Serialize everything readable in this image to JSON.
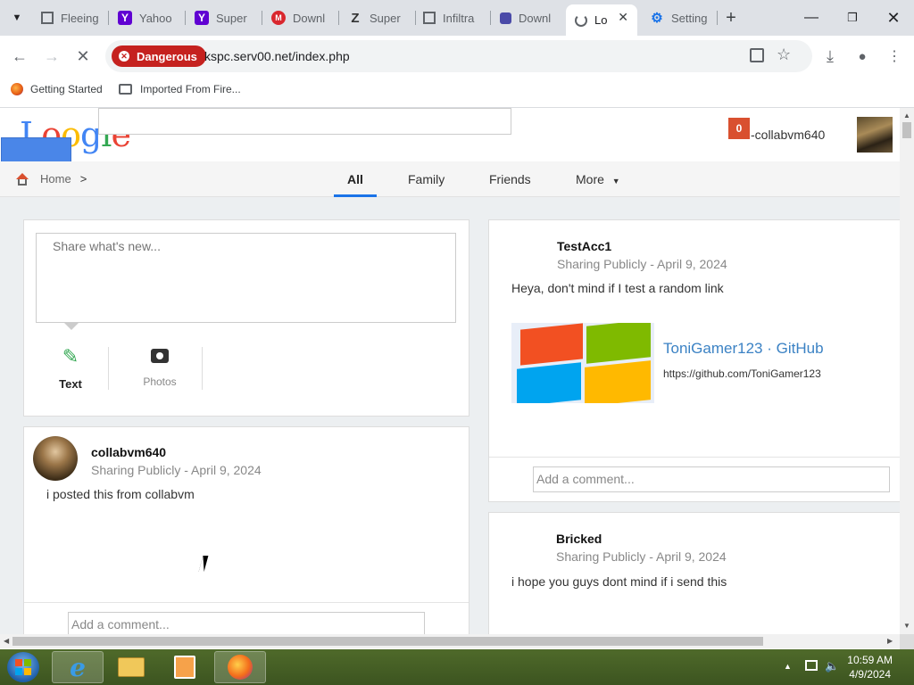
{
  "tabs": [
    {
      "title": "Fleeing",
      "icon": "building-icon",
      "color": "#5f6368"
    },
    {
      "title": "Yahoo",
      "icon": "yahoo-icon",
      "color": "#6001d2"
    },
    {
      "title": "Super",
      "icon": "yahoo-icon",
      "color": "#6001d2"
    },
    {
      "title": "Downl",
      "icon": "mega-icon",
      "color": "#d9272e"
    },
    {
      "title": "Super",
      "icon": "z-icon",
      "color": "#333333"
    },
    {
      "title": "Infiltra",
      "icon": "building-icon",
      "color": "#5f6368"
    },
    {
      "title": "Downl",
      "icon": "puzzle-icon",
      "color": "#4a4aa8"
    },
    {
      "title": "Lo",
      "icon": "loading-icon",
      "color": "#5f6368"
    },
    {
      "title": "Setting",
      "icon": "gear-icon",
      "color": "#1a73e8"
    }
  ],
  "toolbar": {
    "danger_label": "Dangerous",
    "url": "kspc.serv00.net/index.php"
  },
  "bookmarks": [
    {
      "label": "Getting Started",
      "icon": "firefox-icon"
    },
    {
      "label": "Imported From Fire...",
      "icon": "folder-icon"
    }
  ],
  "site": {
    "logo_letters": [
      "L",
      "o",
      "o",
      "g",
      "l",
      "e"
    ],
    "logo_colors": [
      "#4285f4",
      "#ea4335",
      "#fbbc05",
      "#4285f4",
      "#34a853",
      "#ea4335"
    ],
    "notif_count": "0",
    "username": "-collabvm640"
  },
  "nav": {
    "home": "Home",
    "sep": ">",
    "tabs": [
      "All",
      "Family",
      "Friends",
      "More"
    ]
  },
  "composer": {
    "placeholder": "Share what's new...",
    "text_label": "Text",
    "photos_label": "Photos"
  },
  "posts_left": [
    {
      "author": "collabvm640",
      "meta": "Sharing Publicly - April 9, 2024",
      "body": "i posted this from collabvm",
      "comment_placeholder": "Add a comment..."
    }
  ],
  "posts_right": [
    {
      "author": "TestAcc1",
      "meta": "Sharing Publicly - April 9, 2024",
      "body": "Heya, don't mind if I test a random link",
      "link_title": "ToniGamer123 · GitHub",
      "link_url": "https://github.com/ToniGamer123",
      "comment_placeholder": "Add a comment..."
    },
    {
      "author": "Bricked",
      "meta": "Sharing Publicly - April 9, 2024",
      "body": "i hope you guys dont mind if i send this"
    }
  ],
  "taskbar": {
    "time": "10:59 AM",
    "date": "4/9/2024"
  }
}
